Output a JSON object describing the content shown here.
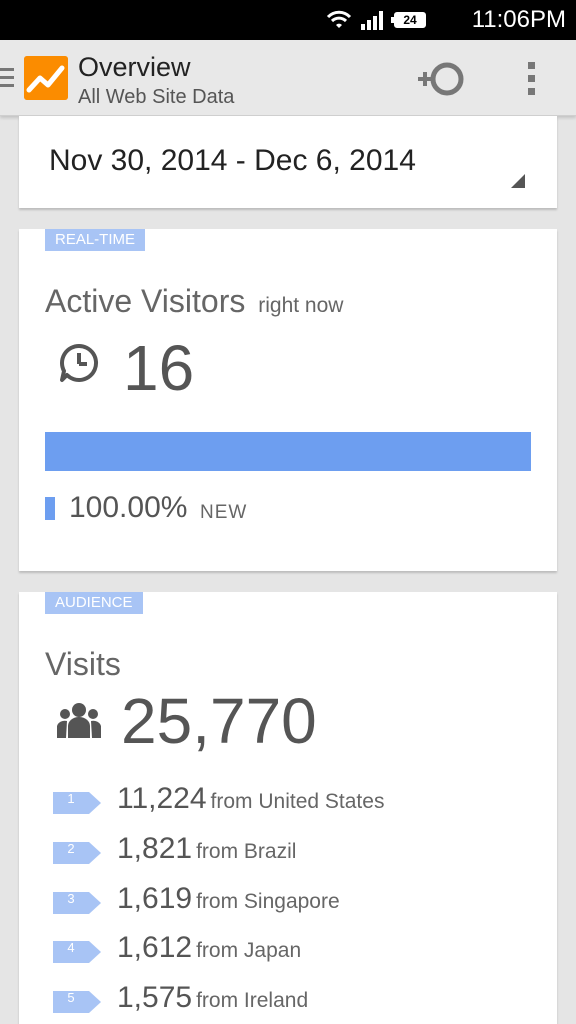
{
  "status_bar": {
    "battery": "24",
    "time": "11:06PM"
  },
  "app_bar": {
    "title": "Overview",
    "subtitle": "All Web Site Data"
  },
  "date_selector": {
    "range": "Nov 30, 2014 - Dec 6, 2014"
  },
  "realtime": {
    "tag": "REAL-TIME",
    "title": "Active Visitors",
    "subtitle": "right now",
    "count": "16",
    "new_percent_value": 1.0,
    "new_percent": "100.00%",
    "new_label": "NEW",
    "accent_color": "#6d9ef0"
  },
  "audience": {
    "tag": "AUDIENCE",
    "title": "Visits",
    "count": "25,770",
    "countries": [
      {
        "rank": "1",
        "value": "11,224",
        "label": "from United States"
      },
      {
        "rank": "2",
        "value": "1,821",
        "label": "from Brazil"
      },
      {
        "rank": "3",
        "value": "1,619",
        "label": "from Singapore"
      },
      {
        "rank": "4",
        "value": "1,612",
        "label": "from Japan"
      },
      {
        "rank": "5",
        "value": "1,575",
        "label": "from Ireland"
      }
    ]
  },
  "icons": {
    "menu": "hamburger-icon",
    "logo": "analytics-logo",
    "segment": "add-segment-icon",
    "overflow": "overflow-menu-icon",
    "clock": "clock-icon",
    "people": "people-icon"
  },
  "colors": {
    "tag_bg": "#a8c4f5",
    "logo_orange": "#f57c00"
  }
}
